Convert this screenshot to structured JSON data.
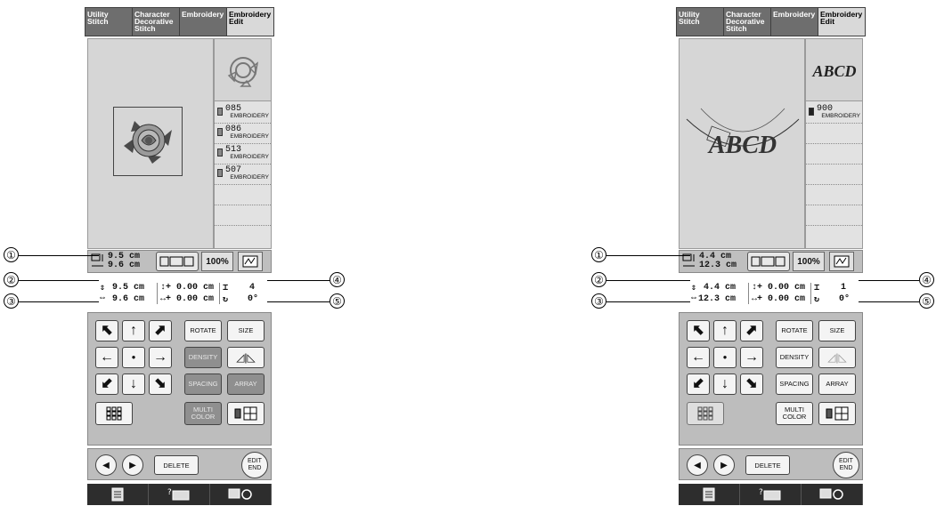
{
  "panels": [
    {
      "tabs": [
        "Utility\nStitch",
        "Character\nDecorative\nStitch",
        "Embroidery",
        "Embroidery\nEdit"
      ],
      "threads": [
        {
          "num": "085",
          "brand": "EMBROIDERY"
        },
        {
          "num": "086",
          "brand": "EMBROIDERY"
        },
        {
          "num": "513",
          "brand": "EMBROIDERY"
        },
        {
          "num": "507",
          "brand": "EMBROIDERY"
        }
      ],
      "sizebar": {
        "height": "9.5 cm",
        "width": "9.6 cm",
        "zoom": "100%"
      },
      "info": {
        "height": "9.5 cm",
        "width": "9.6 cm",
        "v_move": "0.00 cm",
        "h_move": "0.00 cm",
        "colors": "4",
        "angle": "0°"
      },
      "buttons": {
        "rotate": "ROTATE",
        "size": "SIZE",
        "density": "DENSITY",
        "spacing": "SPACING",
        "array": "ARRAY",
        "multi": "MULTI\nCOLOR",
        "delete": "DELETE",
        "edit_end": "EDIT\nEND"
      }
    },
    {
      "tabs": [
        "Utility\nStitch",
        "Character\nDecorative\nStitch",
        "Embroidery",
        "Embroidery\nEdit"
      ],
      "thumb_text": "ABCD",
      "design_text": "ABCD",
      "threads": [
        {
          "num": "900",
          "brand": "EMBROIDERY"
        }
      ],
      "sizebar": {
        "height": "4.4 cm",
        "width": "12.3 cm",
        "zoom": "100%"
      },
      "info": {
        "height": "4.4 cm",
        "width": "12.3 cm",
        "v_move": "0.00 cm",
        "h_move": "0.00 cm",
        "colors": "1",
        "angle": "0°"
      },
      "buttons": {
        "rotate": "ROTATE",
        "size": "SIZE",
        "density": "DENSITY",
        "spacing": "SPACING",
        "array": "ARRAY",
        "multi": "MULTI\nCOLOR",
        "delete": "DELETE",
        "edit_end": "EDIT\nEND"
      }
    }
  ],
  "callouts": [
    "①",
    "②",
    "③",
    "④",
    "⑤"
  ],
  "symbols": {
    "up_down": "↕+",
    "left_right": "↔+"
  },
  "colors": {
    "tab_active": "#d9d9d9",
    "tab_inactive": "#6e6e6e",
    "work_area": "#d6d6d6",
    "panel": "#bdbdbd",
    "dim_button": "#8f8f8f",
    "bottom_bar": "#2d2d2d"
  }
}
